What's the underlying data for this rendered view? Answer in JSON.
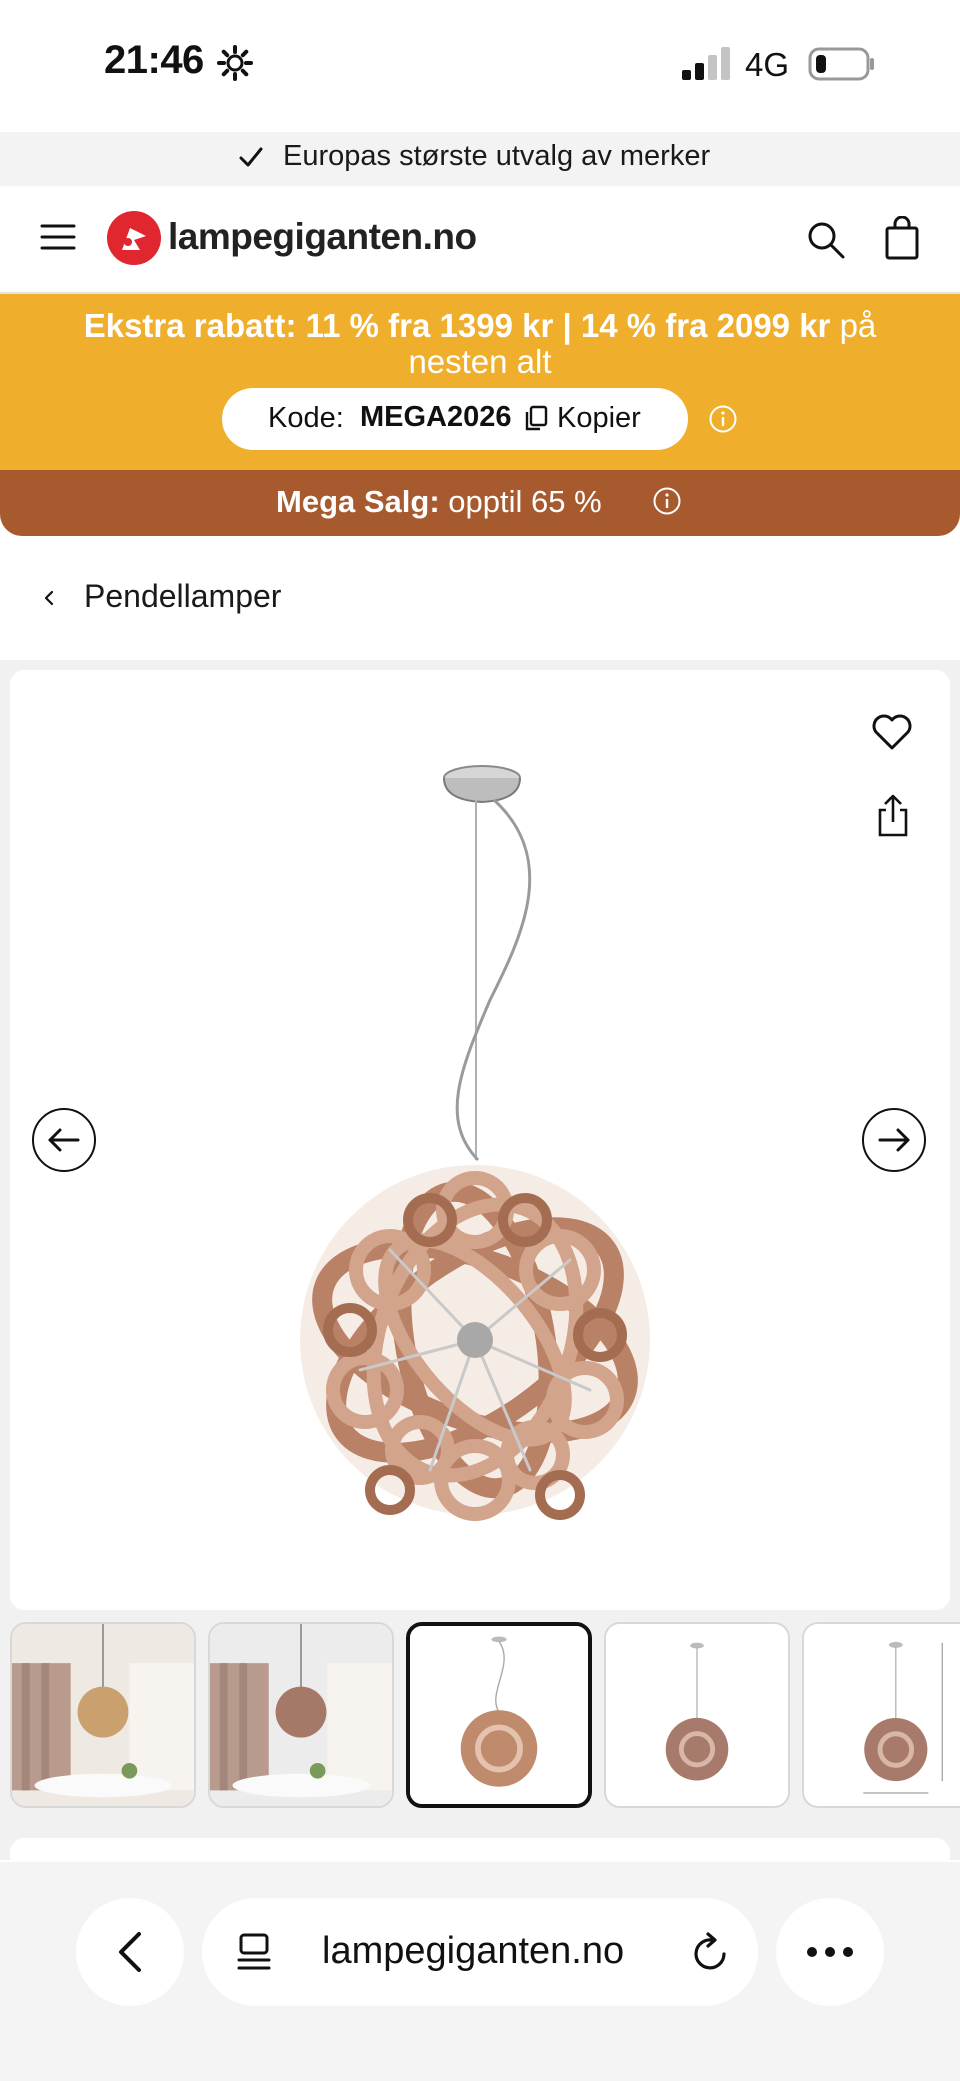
{
  "status_bar": {
    "time": "21:46",
    "network": "4G"
  },
  "promo": {
    "text": "Europas største utvalg av merker"
  },
  "header": {
    "logo_text": "lampegiganten.no"
  },
  "discount": {
    "headline_bold": "Ekstra rabatt: 11 % fra 1399 kr | 14 % fra 2099 kr",
    "headline_tail": " på nesten alt",
    "code_label": "Kode:",
    "code_value": "MEGA2026",
    "copy_label": "Kopier"
  },
  "mega": {
    "bold": "Mega Salg:",
    "tail": " opptil 65 %"
  },
  "breadcrumb": {
    "label": "Pendellamper"
  },
  "gallery": {
    "thumbnails": [
      {
        "icon": "room-scene",
        "active": false
      },
      {
        "icon": "room-scene",
        "active": false
      },
      {
        "icon": "product",
        "active": true
      },
      {
        "icon": "product",
        "active": false
      },
      {
        "icon": "product-dimensions",
        "active": false
      }
    ]
  },
  "browser": {
    "url": "lampegiganten.no"
  },
  "colors": {
    "discount_bg": "#efae2b",
    "mega_bg": "#a85a2f",
    "brand_red": "#e0262f",
    "copper": "#c08a6c"
  }
}
